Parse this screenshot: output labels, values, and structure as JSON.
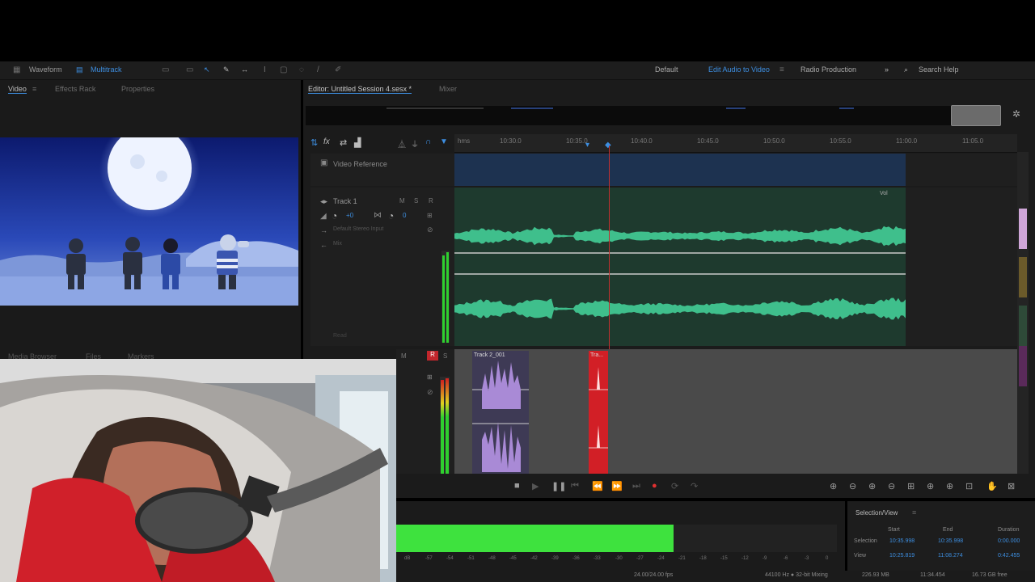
{
  "toolbar": {
    "waveform_label": "Waveform",
    "multitrack_label": "Multitrack",
    "workspaces": [
      "Default",
      "Edit Audio to Video",
      "Radio Production"
    ],
    "more_label": "»",
    "search_placeholder": "Search Help"
  },
  "left_panel": {
    "tabs": [
      "Video",
      "Effects Rack",
      "Properties"
    ],
    "bottom_tabs": [
      "Media Browser",
      "Files",
      "Markers"
    ]
  },
  "editor": {
    "tabs": [
      "Editor: Untitled Session 4.sesx *",
      "Mixer"
    ],
    "ruler": {
      "unit_label": "hms",
      "ticks": [
        "10:30.0",
        "10:35.0",
        "10:40.0",
        "10:45.0",
        "10:50.0",
        "10:55.0",
        "11:00.0",
        "11:05.0"
      ]
    },
    "video_reference_label": "Video Reference",
    "track1": {
      "name": "Track 1",
      "volume": "+0",
      "pan": "0",
      "input": "Default Stereo Input",
      "output": "Mix",
      "read_label": "Read",
      "volume_clip_label": "Vol"
    },
    "track2": {
      "clip1_name": "Track 2_001",
      "clip2_name": "Tra..."
    },
    "track_buttons": [
      "M",
      "S",
      "R"
    ]
  },
  "transport": {
    "buttons": [
      "stop",
      "play",
      "pause",
      "go-to-start",
      "rewind",
      "fast-forward",
      "go-to-end",
      "record",
      "loop",
      "skip"
    ]
  },
  "level_meter": {
    "level": 0.63,
    "scale": [
      "dB",
      "-57",
      "-54",
      "-51",
      "-48",
      "-45",
      "-42",
      "-39",
      "-36",
      "-33",
      "-30",
      "-27",
      "-24",
      "-21",
      "-18",
      "-15",
      "-12",
      "-9",
      "-6",
      "-3",
      "0"
    ]
  },
  "selection_view": {
    "title": "Selection/View",
    "headers": [
      "Start",
      "End",
      "Duration"
    ],
    "rows": [
      {
        "label": "Selection",
        "start": "10:35.998",
        "end": "10:35.998",
        "duration": "0:00.000"
      },
      {
        "label": "View",
        "start": "10:25.819",
        "end": "11:08.274",
        "duration": "0:42.455"
      }
    ]
  },
  "status_bar": {
    "fps": "24.00/24.00 fps",
    "format": "44100 Hz ● 32-bit Mixing",
    "size": "226.93 MB",
    "duration": "11:34.454",
    "free": "16.73 GB free"
  },
  "colors": {
    "accent": "#3d8ee0",
    "track1_waveform": "#3fbf8c",
    "track2_clip1": "#a98ad6",
    "track2_clip2": "#d21f26",
    "level_green": "#3ee23e"
  }
}
